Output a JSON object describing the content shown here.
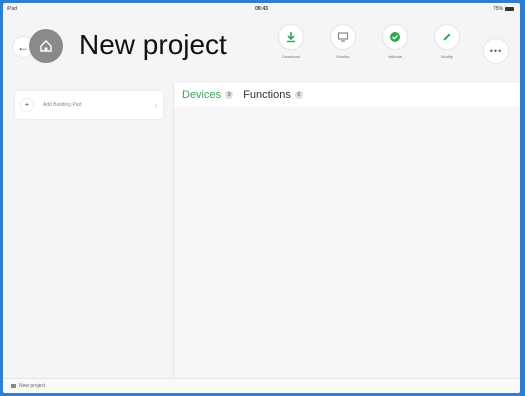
{
  "statusbar": {
    "device": "iPad",
    "time": "09:43",
    "battery": "75%"
  },
  "header": {
    "title": "New project",
    "back_icon": "arrow-left-icon",
    "home_icon": "home-icon"
  },
  "toolbar": {
    "items": [
      {
        "label": "Download",
        "icon": "download-icon",
        "color": "#3aa757"
      },
      {
        "label": "Monitor",
        "icon": "monitor-icon",
        "color": "#888888"
      },
      {
        "label": "Validate",
        "icon": "check-circle-icon",
        "color": "#2fa84f"
      },
      {
        "label": "Modify",
        "icon": "pencil-icon",
        "color": "#3aa757"
      }
    ],
    "more_icon": "more-icon"
  },
  "sidebar": {
    "add_label": "Add Building Part"
  },
  "tabs": [
    {
      "label": "Devices",
      "count": "0",
      "active": true
    },
    {
      "label": "Functions",
      "count": "0",
      "active": false
    }
  ],
  "footer": {
    "label": "New project"
  },
  "colors": {
    "accent": "#3aa757",
    "frame": "#2f7fd1"
  }
}
